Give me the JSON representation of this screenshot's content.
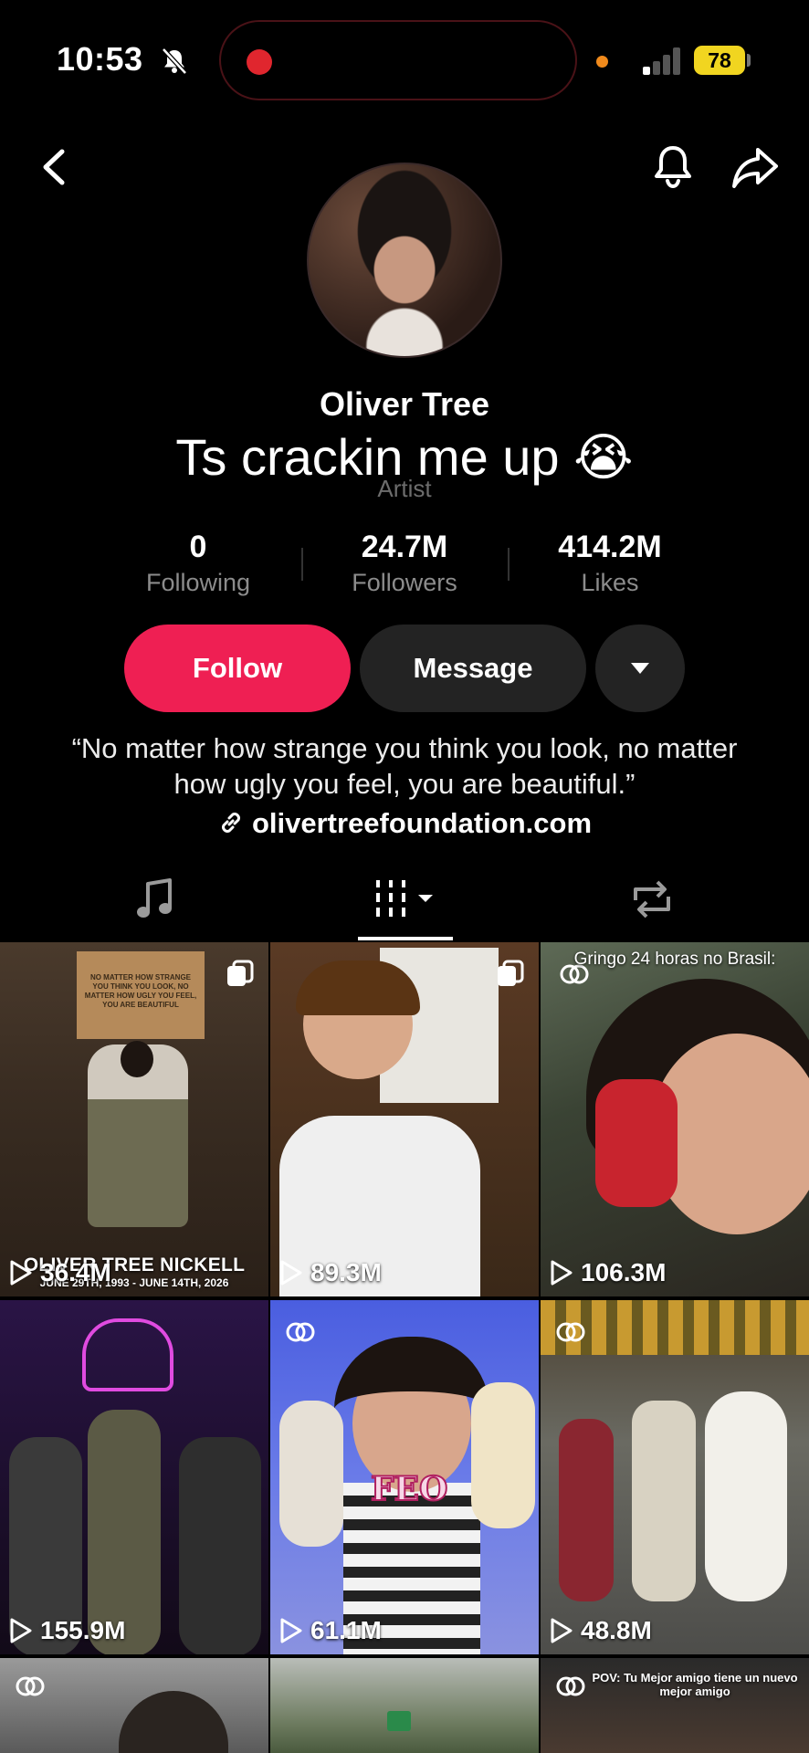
{
  "status_bar": {
    "time": "10:53",
    "battery": "78"
  },
  "profile": {
    "name": "Oliver Tree",
    "subtitle": "Artist",
    "overlay_caption": "Ts crackin me up 😭",
    "stats": [
      {
        "value": "0",
        "label": "Following"
      },
      {
        "value": "24.7M",
        "label": "Followers"
      },
      {
        "value": "414.2M",
        "label": "Likes"
      }
    ],
    "bio": "“No matter how strange you think you look, no matter how ugly you feel, you are beautiful.”",
    "link": "olivertreefoundation.com"
  },
  "buttons": {
    "follow": "Follow",
    "message": "Message"
  },
  "tabs": [
    "music-tab",
    "videos-tab",
    "reposts-tab"
  ],
  "videos": [
    {
      "views": "36.4M",
      "caption": "OLIVER TREE NICKELL",
      "subcaption": "JUNE 29TH, 1993 - JUNE 14TH, 2026",
      "badge": "pinned-copy-icon",
      "box_text": "NO MATTER HOW STRANGE YOU THINK YOU LOOK, NO MATTER HOW UGLY YOU FEEL, YOU ARE BEAUTIFUL"
    },
    {
      "views": "89.3M",
      "badge": "pinned-copy-icon"
    },
    {
      "views": "106.3M",
      "caption": "Gringo 24 horas no Brasil:",
      "badge": "collab-icon"
    },
    {
      "views": "155.9M"
    },
    {
      "views": "61.1M",
      "badge": "collab-icon",
      "sticker": "FEO"
    },
    {
      "views": "48.8M",
      "badge": "collab-icon"
    },
    {
      "badge": "collab-icon"
    },
    {},
    {
      "caption": "POV: Tu Mejor amigo tiene un nuevo mejor amigo",
      "badge": "collab-icon"
    }
  ]
}
